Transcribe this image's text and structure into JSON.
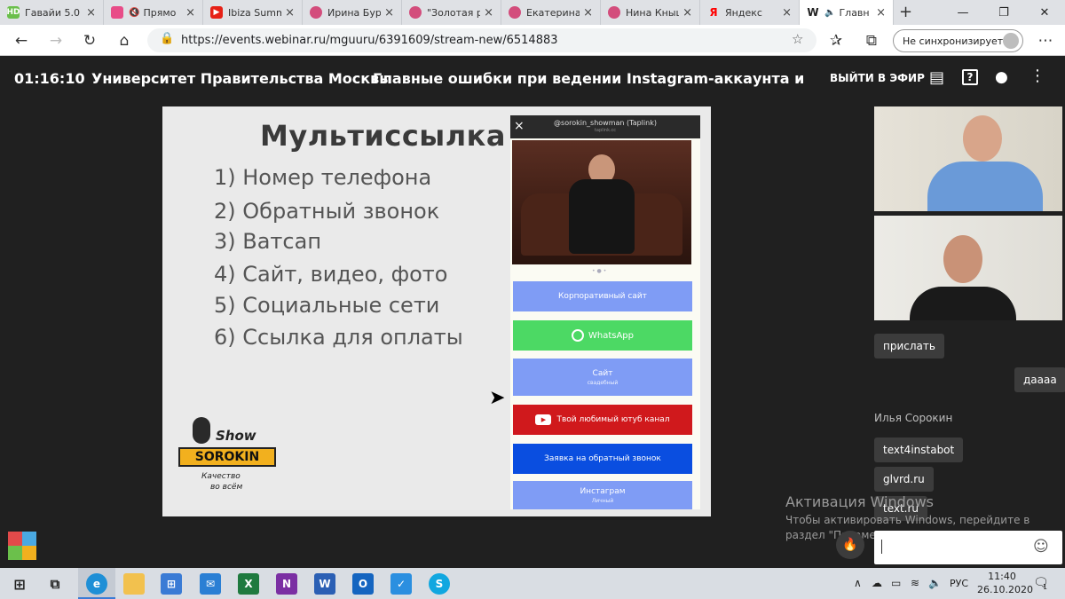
{
  "browser": {
    "tabs": [
      {
        "label": "Гавайи 5.0",
        "icon_color": "#6abf4b",
        "icon_text": "HD"
      },
      {
        "label": "Прямо",
        "icon_color": "#e84c88",
        "icon_text": ""
      },
      {
        "label": "Ibiza Summ",
        "icon_color": "#e62117",
        "icon_text": "▶"
      },
      {
        "label": "Ирина Бур",
        "icon_color": "#d34d7c",
        "icon_text": ""
      },
      {
        "label": "\"Золотая р",
        "icon_color": "#d34d7c",
        "icon_text": ""
      },
      {
        "label": "Екатерина .",
        "icon_color": "#d34d7c",
        "icon_text": ""
      },
      {
        "label": "Нина Кныш",
        "icon_color": "#d34d7c",
        "icon_text": ""
      },
      {
        "label": "Яндекс",
        "icon_color": "#ff0000",
        "icon_text": "Я"
      },
      {
        "label": "Главн",
        "icon_color": "#222222",
        "icon_text": "W"
      }
    ],
    "mute_glyph": "🔇",
    "new_tab": "+",
    "url": "https://events.webinar.ru/mguuru/6391609/stream-new/6514883",
    "sync_label": "Не синхронизируется"
  },
  "header": {
    "timer": "01:16:10",
    "org": "Университет Правительства Москвы",
    "title": "Главные ошибки при ведении Instagram-аккаунта и как их...",
    "go_live": "ВЫЙТИ В ЭФИР"
  },
  "slide": {
    "title": "Мультиссылка",
    "items": [
      "1) Номер телефона",
      "2) Обратный звонок",
      "3) Ватсап",
      "4) Сайт, видео, фото",
      "5) Социальные сети",
      "6) Ссылка для оплаты"
    ],
    "logo": {
      "top": "Show",
      "main": "SOROKIN",
      "tagline1": "Качество",
      "tagline2": "во всём"
    },
    "phone": {
      "handle": "@sorokin_showman (Taplink)",
      "subhandle": "taplink.cc",
      "buttons": [
        {
          "label": "Корпоративный сайт",
          "sub": "",
          "color": "#7f9cf5"
        },
        {
          "label": "WhatsApp",
          "sub": "",
          "color": "#4cd964"
        },
        {
          "label": "Сайт",
          "sub": "свадебный",
          "color": "#7f9cf5"
        },
        {
          "label": "Твой любимый ютуб канал",
          "sub": "",
          "color": "#d0191c"
        },
        {
          "label": "Заявка на обратный звонок",
          "sub": "",
          "color": "#0a4ee0"
        },
        {
          "label": "Инстаграм",
          "sub": "Личный",
          "color": "#7f9cf5"
        }
      ]
    }
  },
  "chat": {
    "messages": [
      {
        "text": "прислать"
      },
      {
        "text": "даааа"
      },
      {
        "text": "text4instabot"
      },
      {
        "text": "glvrd.ru"
      },
      {
        "text": "text.ru"
      }
    ],
    "sender": "Илья Сорокин"
  },
  "watermark": {
    "line1": "Активация Windows",
    "line2": "Чтобы активировать Windows, перейдите в раздел \"Параметры\"."
  },
  "taskbar": {
    "lang": "РУС",
    "time": "11:40",
    "date": "26.10.2020",
    "notif_count": "1"
  }
}
